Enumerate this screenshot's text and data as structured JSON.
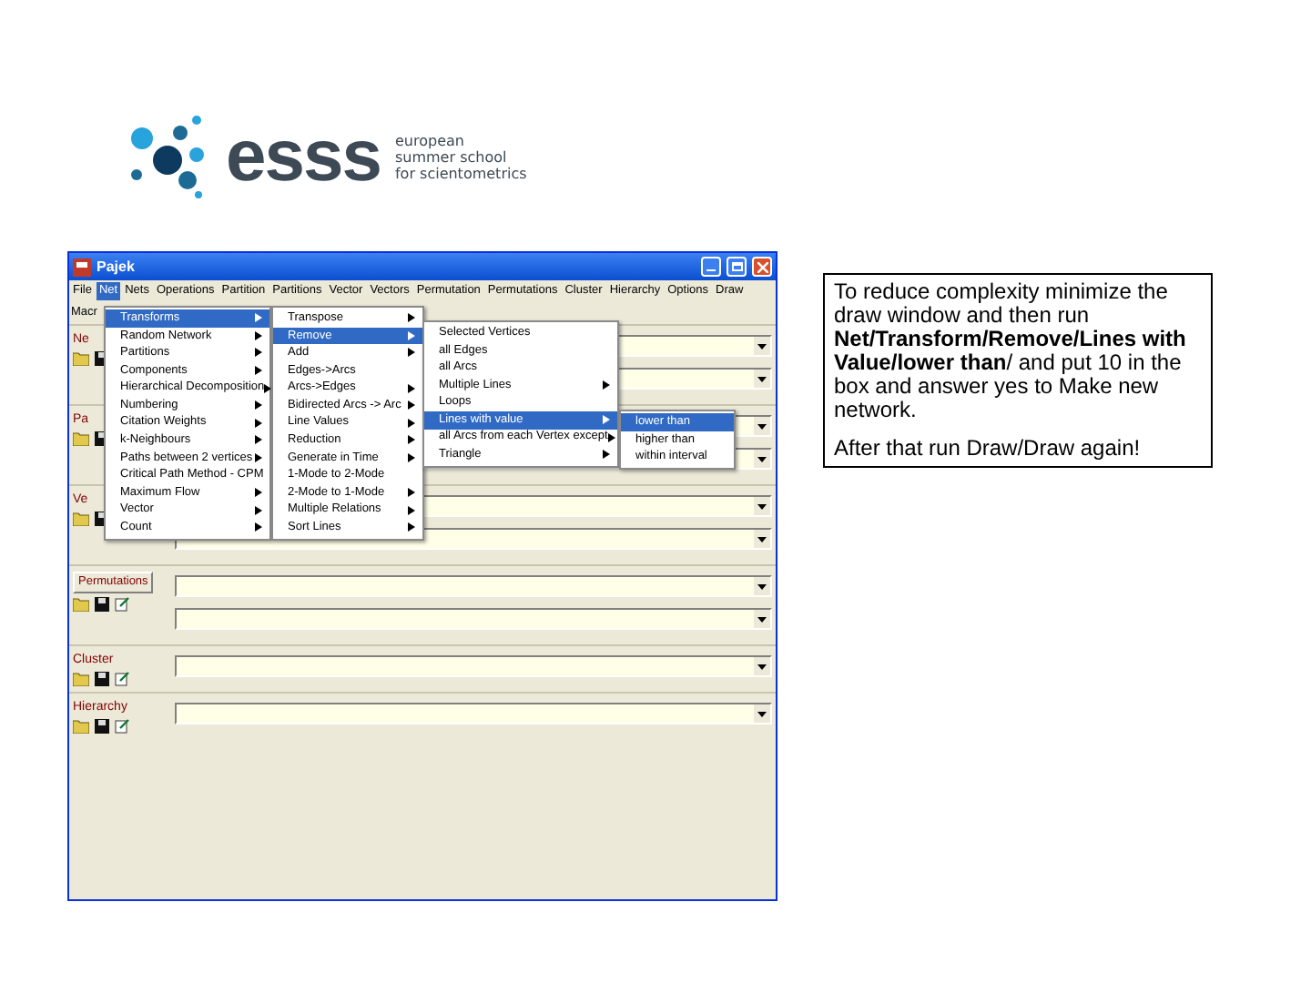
{
  "logo": {
    "mark": "esss",
    "lines": [
      "european",
      "summer school",
      "for scientometrics"
    ]
  },
  "window": {
    "title": "Pajek"
  },
  "menu_bar": [
    {
      "label": "File",
      "selected": false
    },
    {
      "label": "Net",
      "selected": true
    },
    {
      "label": "Nets",
      "selected": false
    },
    {
      "label": "Operations",
      "selected": false
    },
    {
      "label": "Partition",
      "selected": false
    },
    {
      "label": "Partitions",
      "selected": false
    },
    {
      "label": "Vector",
      "selected": false
    },
    {
      "label": "Vectors",
      "selected": false
    },
    {
      "label": "Permutation",
      "selected": false
    },
    {
      "label": "Permutations",
      "selected": false
    },
    {
      "label": "Cluster",
      "selected": false
    },
    {
      "label": "Hierarchy",
      "selected": false
    },
    {
      "label": "Options",
      "selected": false
    },
    {
      "label": "Draw",
      "selected": false
    }
  ],
  "menu_bar_row2": [
    {
      "label": "Macr",
      "selected": false
    }
  ],
  "menus": [
    {
      "items": [
        {
          "label": "Transforms",
          "submenu": true,
          "selected": true
        },
        {
          "label": "Random Network",
          "submenu": true,
          "selected": false
        },
        {
          "label": "Partitions",
          "submenu": true,
          "selected": false
        },
        {
          "label": "Components",
          "submenu": true,
          "selected": false
        },
        {
          "label": "Hierarchical Decomposition",
          "submenu": true,
          "selected": false
        },
        {
          "label": "Numbering",
          "submenu": true,
          "selected": false
        },
        {
          "label": "Citation Weights",
          "submenu": true,
          "selected": false
        },
        {
          "label": "k-Neighbours",
          "submenu": true,
          "selected": false
        },
        {
          "label": "Paths between 2 vertices",
          "submenu": true,
          "selected": false
        },
        {
          "label": "Critical Path Method - CPM",
          "submenu": false,
          "selected": false
        },
        {
          "label": "Maximum Flow",
          "submenu": true,
          "selected": false
        },
        {
          "label": "Vector",
          "submenu": true,
          "selected": false
        },
        {
          "label": "Count",
          "submenu": true,
          "selected": false
        }
      ]
    },
    {
      "items": [
        {
          "label": "Transpose",
          "submenu": true,
          "selected": false
        },
        {
          "label": "Remove",
          "submenu": true,
          "selected": true
        },
        {
          "label": "Add",
          "submenu": true,
          "selected": false
        },
        {
          "label": "Edges->Arcs",
          "submenu": false,
          "selected": false
        },
        {
          "label": "Arcs->Edges",
          "submenu": true,
          "selected": false
        },
        {
          "label": "Bidirected Arcs -> Arc",
          "submenu": true,
          "selected": false
        },
        {
          "label": "Line Values",
          "submenu": true,
          "selected": false
        },
        {
          "label": "Reduction",
          "submenu": true,
          "selected": false
        },
        {
          "label": "Generate in Time",
          "submenu": true,
          "selected": false
        },
        {
          "label": "1-Mode to 2-Mode",
          "submenu": false,
          "selected": false
        },
        {
          "label": "2-Mode to 1-Mode",
          "submenu": true,
          "selected": false
        },
        {
          "label": "Multiple Relations",
          "submenu": true,
          "selected": false
        },
        {
          "label": "Sort Lines",
          "submenu": true,
          "selected": false
        }
      ]
    },
    {
      "items": [
        {
          "label": "Selected Vertices",
          "submenu": false,
          "selected": false
        },
        {
          "label": "all Edges",
          "submenu": false,
          "selected": false
        },
        {
          "label": "all Arcs",
          "submenu": false,
          "selected": false
        },
        {
          "label": "Multiple Lines",
          "submenu": true,
          "selected": false
        },
        {
          "label": "Loops",
          "submenu": false,
          "selected": false
        },
        {
          "label": "Lines with value",
          "submenu": true,
          "selected": true
        },
        {
          "label": "all Arcs from each Vertex except",
          "submenu": true,
          "selected": false
        },
        {
          "label": "Triangle",
          "submenu": true,
          "selected": false
        }
      ]
    },
    {
      "items": [
        {
          "label": "lower than",
          "submenu": false,
          "selected": true
        },
        {
          "label": "higher than",
          "submenu": false,
          "selected": false
        },
        {
          "label": "within interval",
          "submenu": false,
          "selected": false
        }
      ]
    }
  ],
  "sections": [
    {
      "label": "Ne",
      "kind": "label",
      "fields": [
        {
          "kind": "dropdown"
        },
        {
          "kind": "dropdown"
        }
      ]
    },
    {
      "label": "Pa",
      "kind": "label",
      "fields": [
        {
          "kind": "dropdown"
        },
        {
          "kind": "dropdown"
        }
      ]
    },
    {
      "label": "Ve",
      "kind": "label",
      "fields": [
        {
          "kind": "dropdown"
        },
        {
          "kind": "dropdown"
        }
      ]
    },
    {
      "label": "Permutations",
      "kind": "button",
      "fields": [
        {
          "kind": "dropdown"
        },
        {
          "kind": "dropdown"
        }
      ]
    },
    {
      "label": "Cluster",
      "kind": "label",
      "fields": [
        {
          "kind": "dropdown"
        }
      ]
    },
    {
      "label": "Hierarchy",
      "kind": "label",
      "fields": [
        {
          "kind": "dropdown"
        }
      ]
    }
  ],
  "note": {
    "paragraphs": [
      "To reduce complexity minimize the draw window and then run **Net/Transform/Remove/Lines with Value/lower than**/  and put 10 in the box and answer yes to Make new network.",
      "After that run Draw/Draw again!"
    ]
  }
}
